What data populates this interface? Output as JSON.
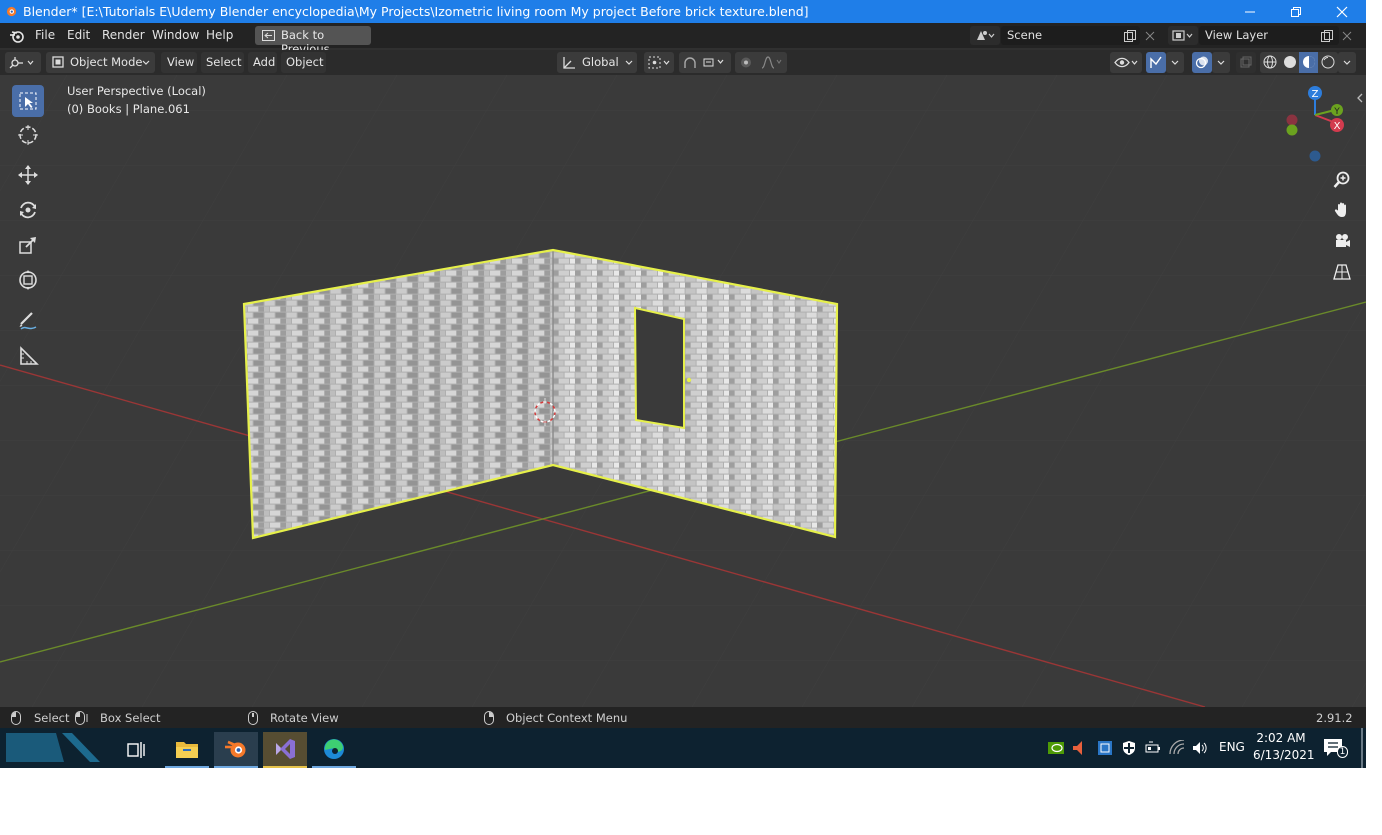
{
  "window": {
    "title": "Blender* [E:\\Tutorials E\\Udemy Blender encyclopedia\\My Projects\\Izometric living room My project Before brick texture.blend]",
    "controls": [
      "minimize-icon",
      "restore-icon",
      "close-icon"
    ]
  },
  "menubar": {
    "items": [
      "File",
      "Edit",
      "Render",
      "Window",
      "Help"
    ],
    "back_button": "Back to Previous",
    "scene": "Scene",
    "view_layer": "View Layer"
  },
  "header": {
    "mode": "Object Mode",
    "menus": [
      "View",
      "Select",
      "Add",
      "Object"
    ],
    "orientation": "Global"
  },
  "viewport": {
    "perspective_label": "User Perspective (Local)",
    "object_label": "(0) Books | Plane.061",
    "gizmo_axes": [
      "Z",
      "Y",
      "X"
    ],
    "selection_outline_color": "#e6f04a",
    "x_axis_color": "#9a3636",
    "y_axis_color": "#6a8a2a"
  },
  "toolbar": [
    "select-box-icon",
    "cursor-icon",
    "move-icon",
    "rotate-icon",
    "scale-icon",
    "transform-icon",
    "annotate-icon",
    "measure-icon"
  ],
  "statusbar": {
    "select": "Select",
    "box_select": "Box Select",
    "rotate": "Rotate View",
    "context": "Object Context Menu",
    "version": "2.91.2"
  },
  "taskbar": {
    "language": "ENG",
    "time": "2:02 AM",
    "date": "6/13/2021",
    "notification_count": "1"
  }
}
